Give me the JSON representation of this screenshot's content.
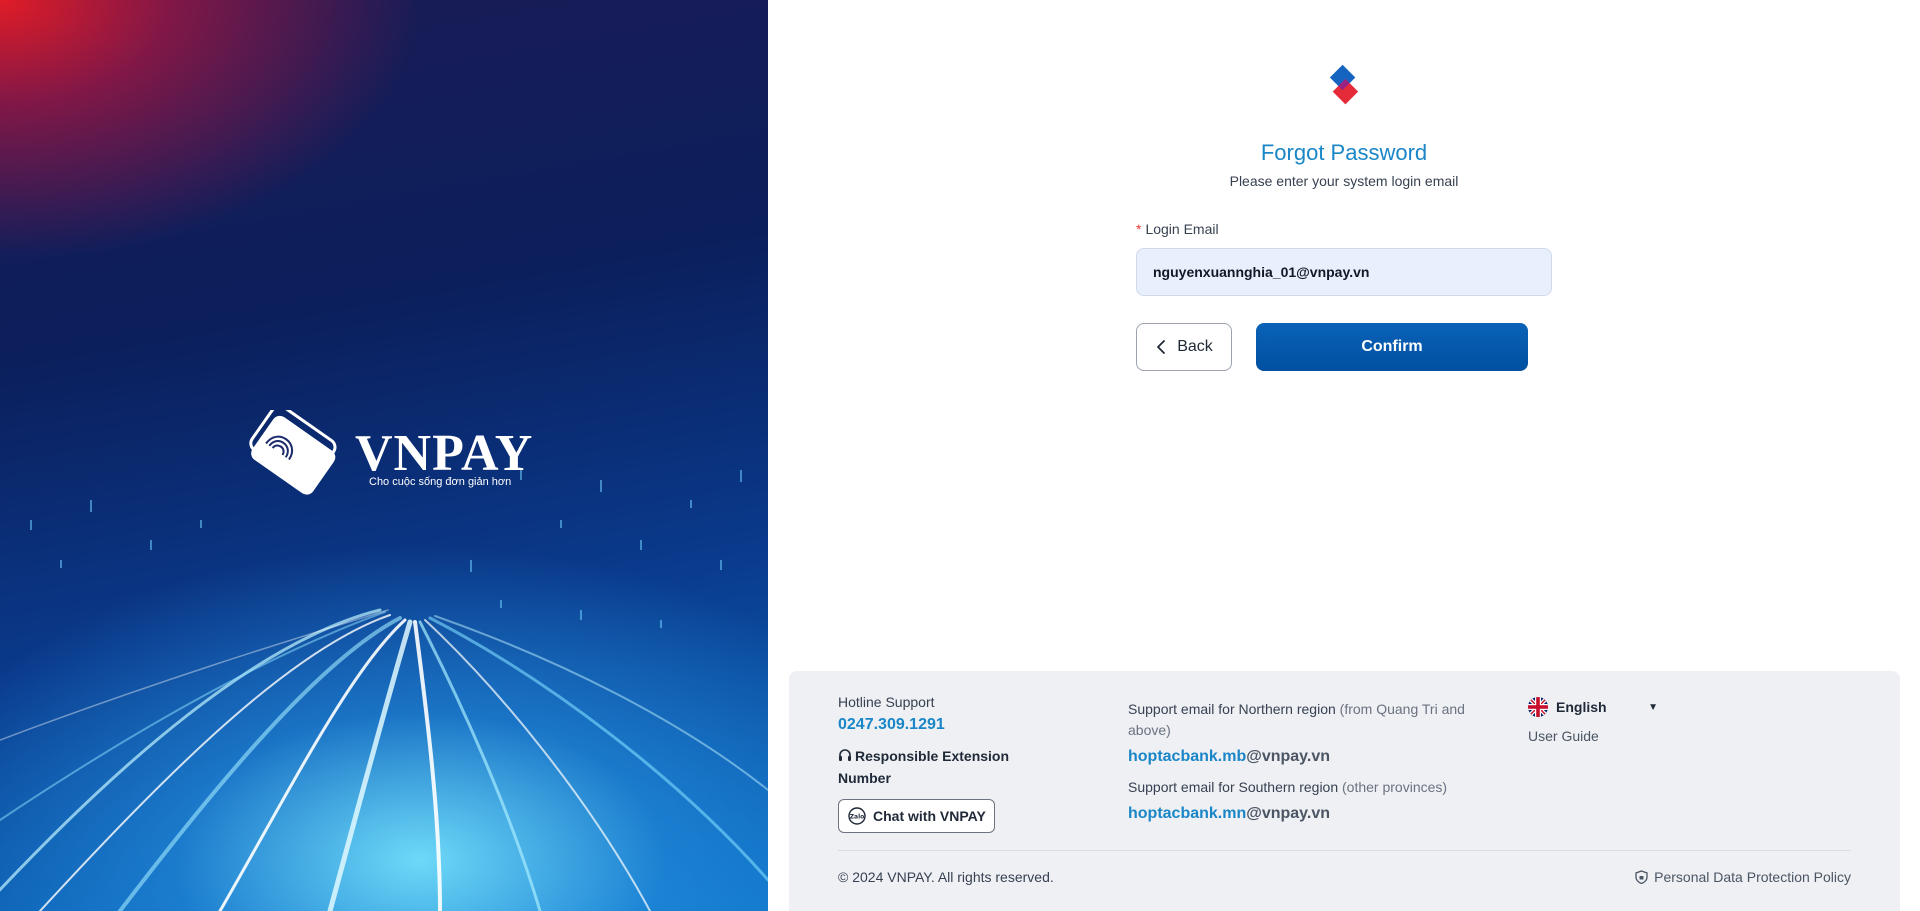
{
  "hero": {
    "brand": "VNPAY",
    "tagline": "Cho cuộc sống đơn giản hơn"
  },
  "form": {
    "title": "Forgot Password",
    "subtitle": "Please enter your system login email",
    "email_label": "Login Email",
    "required_mark": "*",
    "email_value": "nguyenxuannghia_01@vnpay.vn",
    "back_label": "Back",
    "confirm_label": "Confirm"
  },
  "footer": {
    "hotline_label": "Hotline Support",
    "hotline_number": "0247.309.1291",
    "extension_label": "Responsible Extension Number",
    "chat_label": "Chat with VNPAY",
    "chat_icon_text": "Zalo",
    "north_label": "Support email for Northern region",
    "north_note": "(from Quang Tri and above)",
    "north_email_user": "hoptacbank.mb",
    "north_email_domain": "@vnpay.vn",
    "south_label": "Support email for Southern region",
    "south_note": "(other provinces)",
    "south_email_user": "hoptacbank.mn",
    "south_email_domain": "@vnpay.vn",
    "language": "English",
    "user_guide": "User Guide",
    "copyright": "© 2024 VNPAY. All rights reserved.",
    "policy": "Personal Data Protection Policy"
  },
  "colors": {
    "accent": "#1a86c7",
    "primary_button": "#0050a0",
    "brand_red": "#e52b3a",
    "brand_blue": "#1565c0"
  },
  "icons": [
    "vnpay-logo-icon",
    "fingerprint-card-icon",
    "chevron-left-icon",
    "headphones-icon",
    "zalo-icon",
    "uk-flag-icon",
    "caret-down-icon",
    "shield-icon"
  ]
}
